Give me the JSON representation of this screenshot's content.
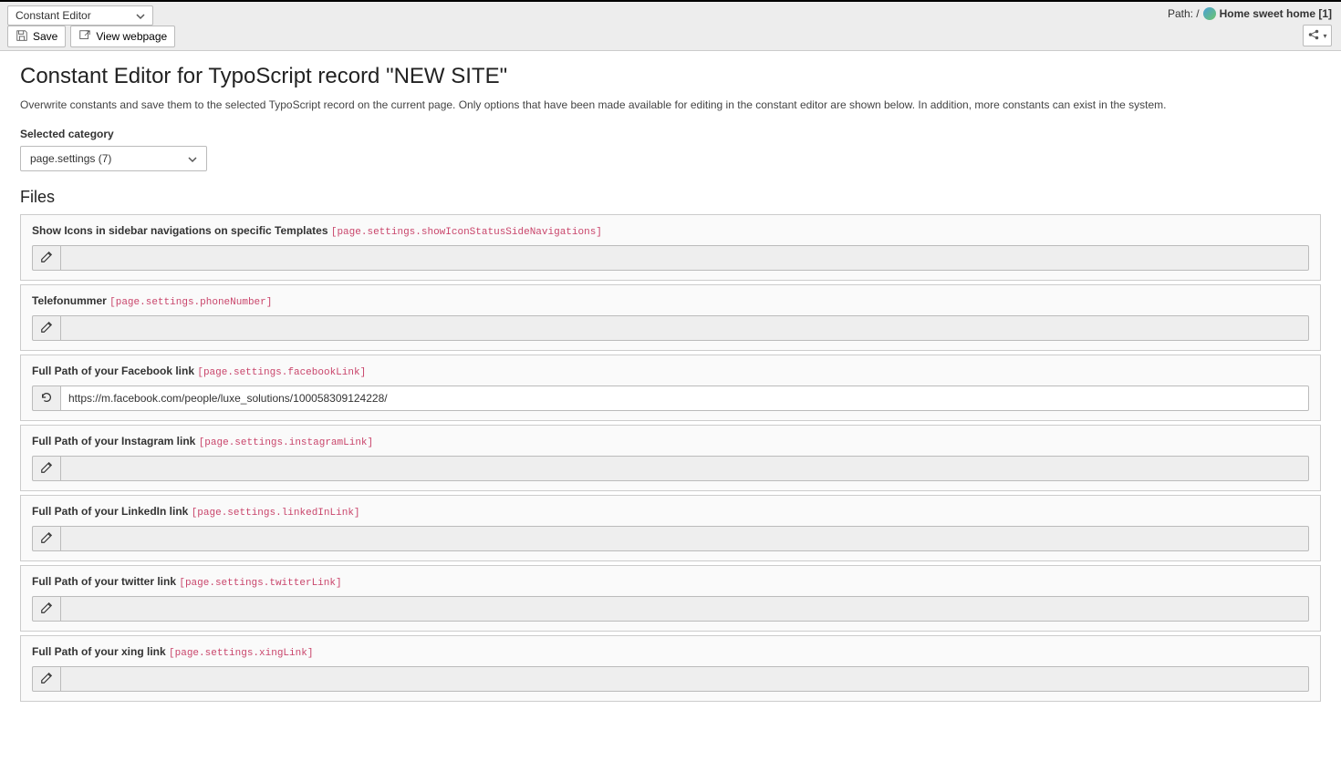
{
  "module_selector": {
    "selected": "Constant Editor"
  },
  "path": {
    "prefix": "Path: /",
    "page_name": "Home sweet home [1]"
  },
  "toolbar": {
    "save_label": "Save",
    "view_label": "View webpage"
  },
  "page_title": "Constant Editor for TypoScript record \"NEW SITE\"",
  "description": "Overwrite constants and save them to the selected TypoScript record on the current page. Only options that have been made available for editing in the constant editor are shown below. In addition, more constants can exist in the system.",
  "category_label": "Selected category",
  "category_selected": "page.settings (7)",
  "section_title": "Files",
  "constants": [
    {
      "label": "Show Icons in sidebar navigations on specific Templates",
      "key": "[page.settings.showIconStatusSideNavigations]",
      "value": "",
      "action": "edit"
    },
    {
      "label": "Telefonummer",
      "key": "[page.settings.phoneNumber]",
      "value": "",
      "action": "edit"
    },
    {
      "label": "Full Path of your Facebook link",
      "key": "[page.settings.facebookLink]",
      "value": "https://m.facebook.com/people/luxe_solutions/100058309124228/",
      "action": "undo"
    },
    {
      "label": "Full Path of your Instagram link",
      "key": "[page.settings.instagramLink]",
      "value": "",
      "action": "edit"
    },
    {
      "label": "Full Path of your LinkedIn link",
      "key": "[page.settings.linkedInLink]",
      "value": "",
      "action": "edit"
    },
    {
      "label": "Full Path of your twitter link",
      "key": "[page.settings.twitterLink]",
      "value": "",
      "action": "edit"
    },
    {
      "label": "Full Path of your xing link",
      "key": "[page.settings.xingLink]",
      "value": "",
      "action": "edit"
    }
  ]
}
